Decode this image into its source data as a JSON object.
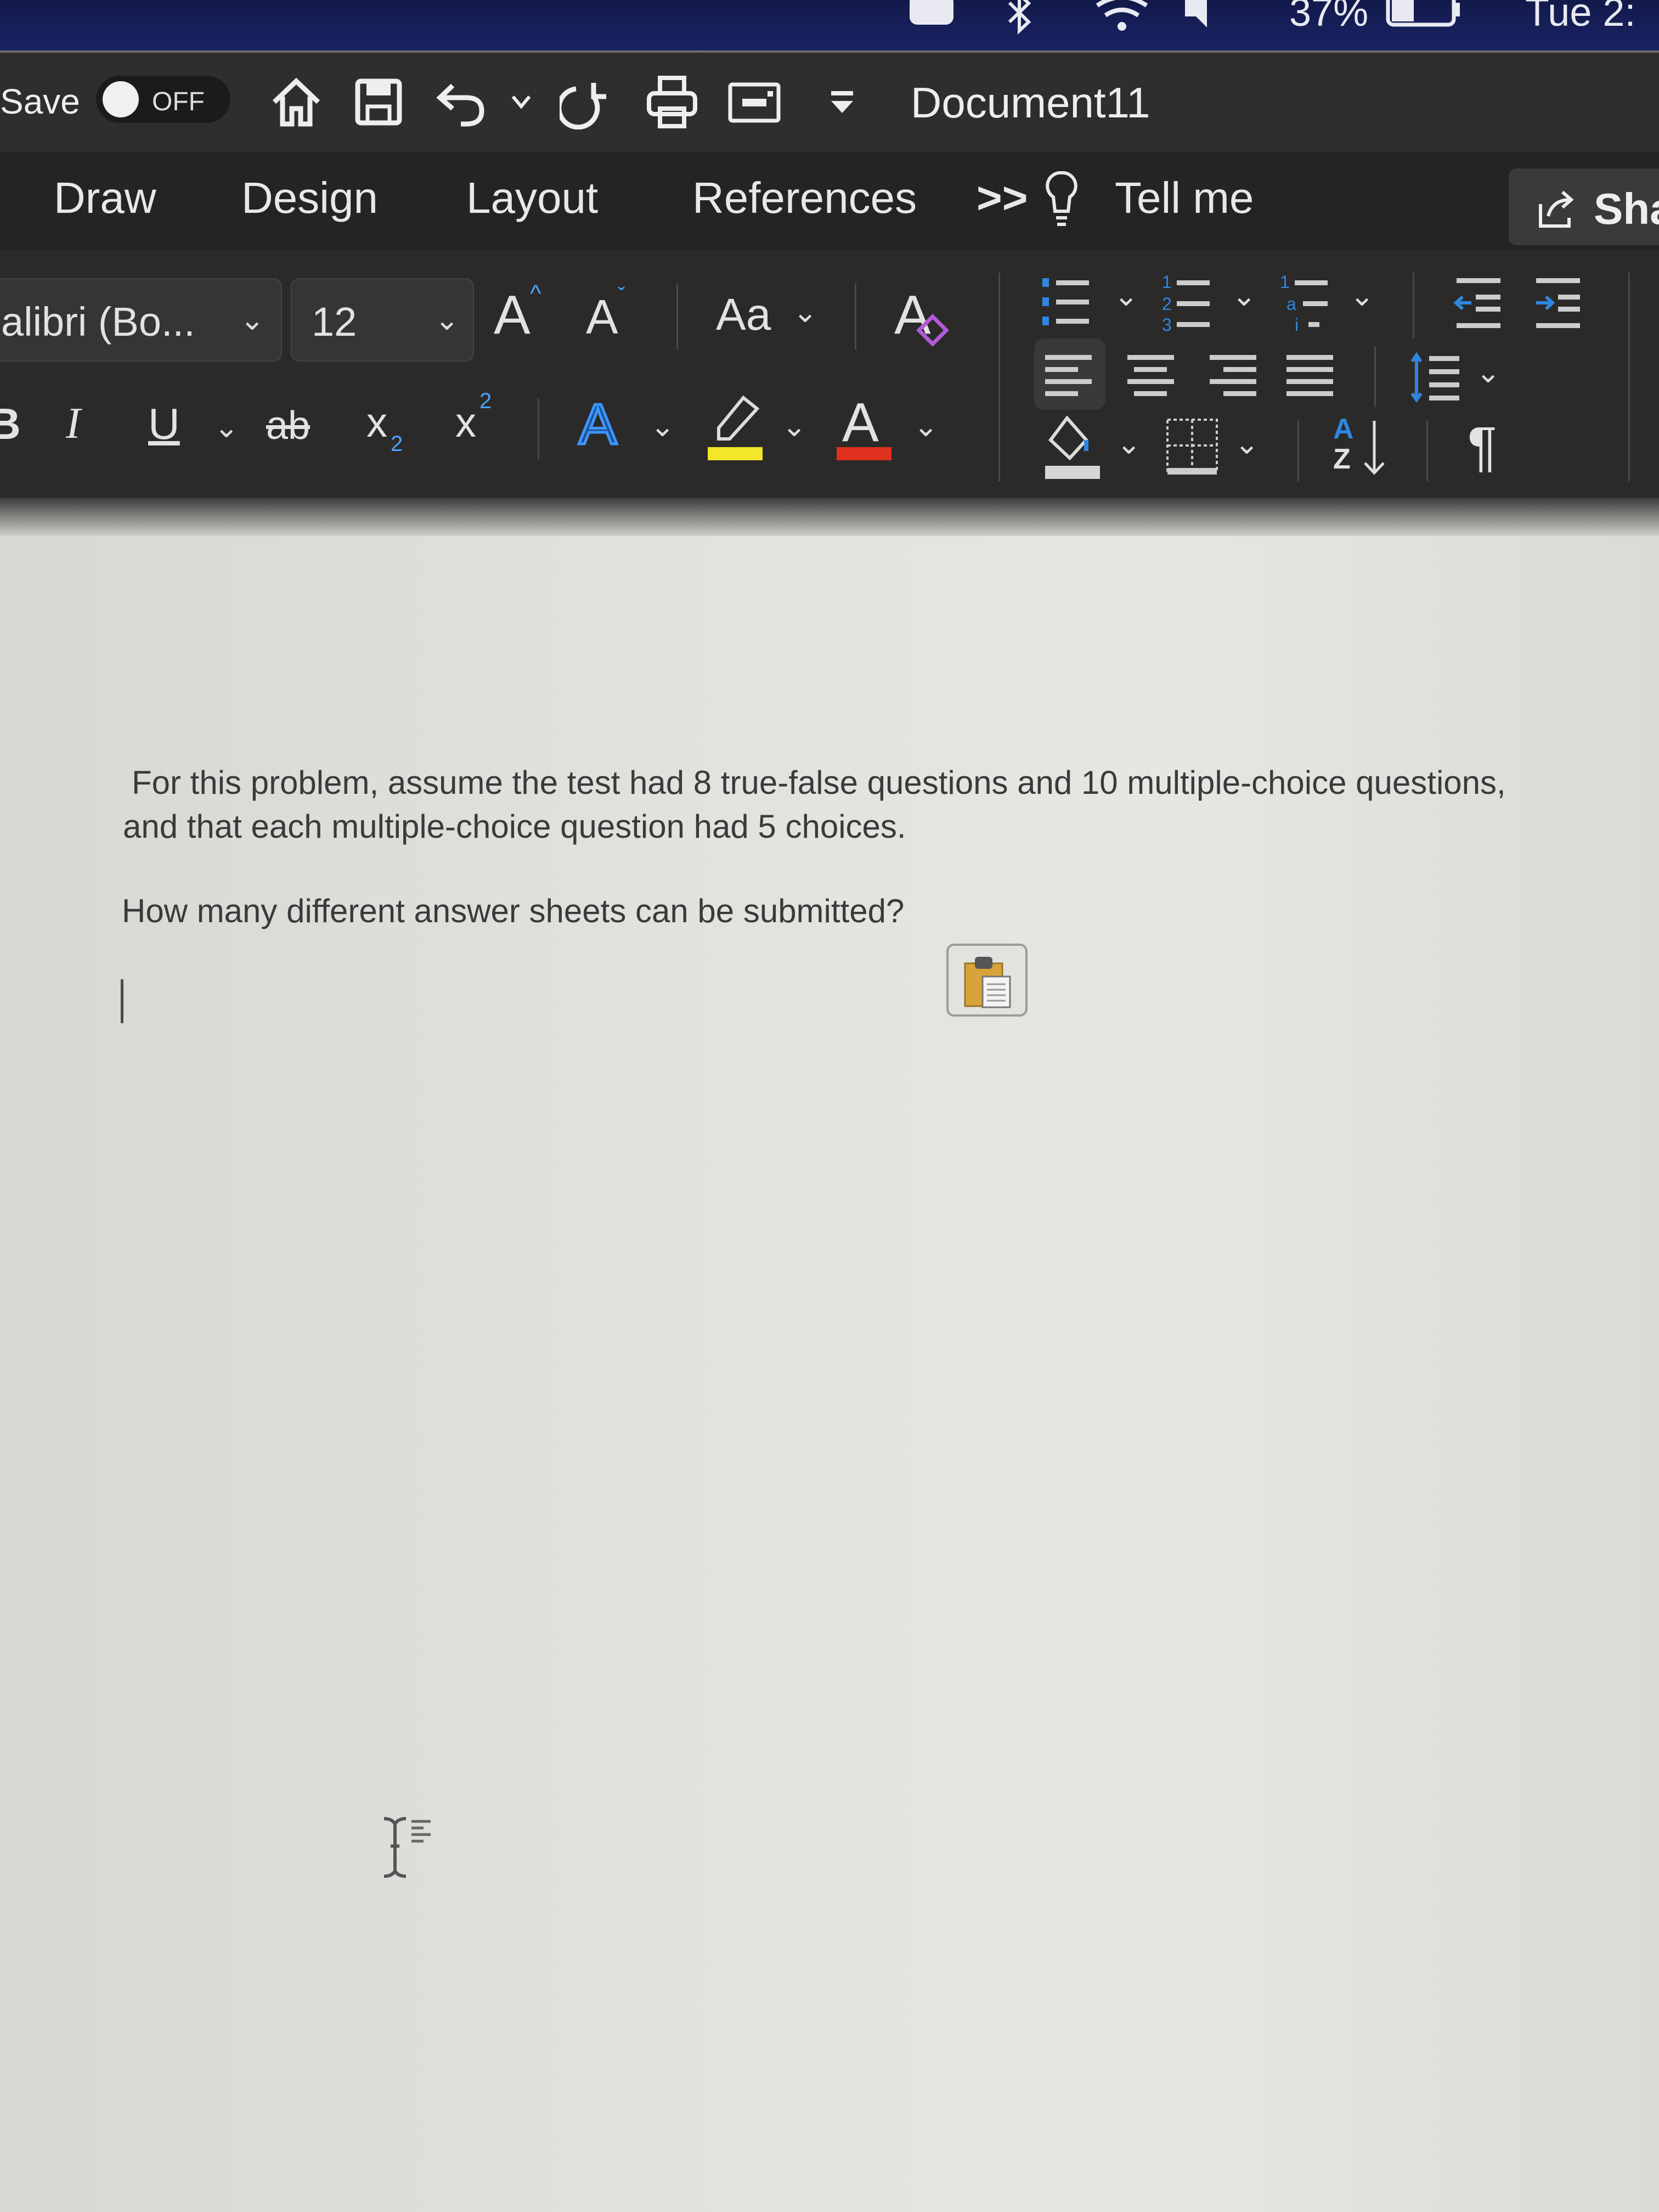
{
  "menubar": {
    "battery_percent": "37%",
    "clock": "Tue 2:",
    "icons": [
      "screen-mirror-icon",
      "bluetooth-icon",
      "wifi-icon",
      "volume-icon",
      "battery-icon"
    ]
  },
  "titlebar": {
    "autosave_label": "Save",
    "autosave_state": "OFF",
    "quick_access": [
      "home-icon",
      "save-icon",
      "undo-icon",
      "undo-dropdown-icon",
      "redo-icon",
      "print-icon",
      "customize-icon",
      "more-icon"
    ],
    "document_title": "Document11"
  },
  "tabs": {
    "items": [
      "Draw",
      "Design",
      "Layout",
      "References"
    ],
    "overflow": ">>",
    "tell_me": "Tell me",
    "share": "Sha"
  },
  "ribbon": {
    "font_name": "alibri (Bo...",
    "font_size": "12",
    "grow_font": "A",
    "shrink_font": "A",
    "change_case": "Aa",
    "clear_format": "A",
    "bold": "B",
    "italic": "I",
    "underline": "U",
    "strikethrough": "ab",
    "subscript": "x",
    "subscript_mark": "2",
    "superscript": "x",
    "superscript_mark": "2",
    "text_effects": "A",
    "font_color": "A",
    "highlight_color": "#f2e62a",
    "font_color_bar": "#e0301e",
    "accent": "#2f86e0",
    "sort_top": "A",
    "sort_bottom": "Z",
    "pilcrow": "¶"
  },
  "document": {
    "paragraph1_line1": "For this problem, assume the test had 8 true-false questions and 10 multiple-choice questions,",
    "paragraph1_line2": "and that each multiple-choice question had 5 choices.",
    "paragraph2": "How many different answer sheets can be submitted?"
  }
}
